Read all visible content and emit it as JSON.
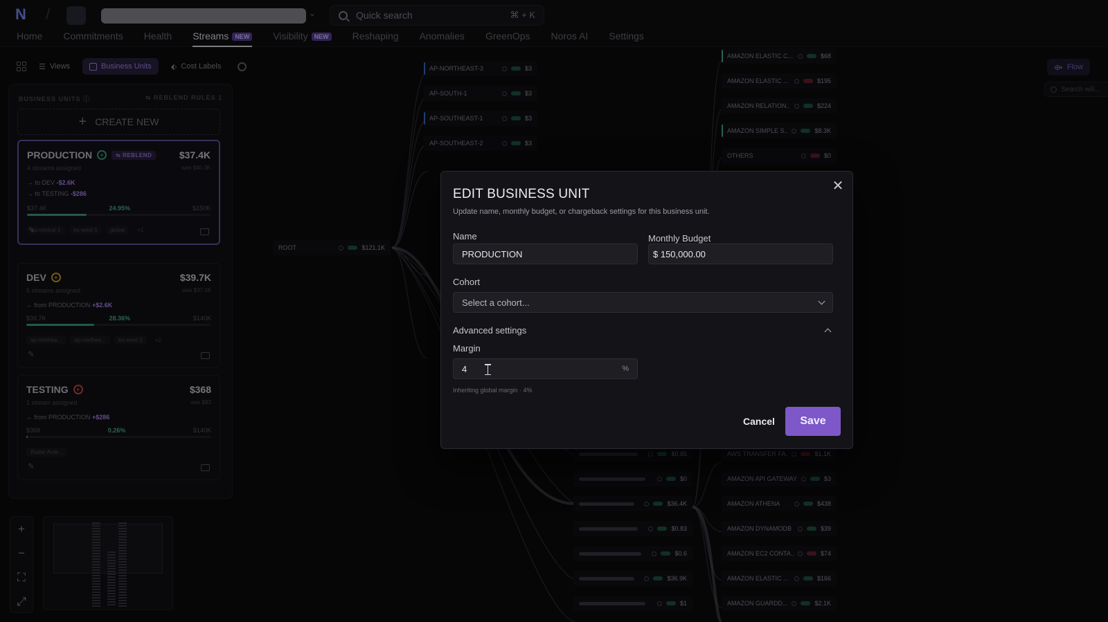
{
  "topbar": {
    "search_placeholder": "Quick search",
    "search_shortcut": "⌘ + K",
    "nav": [
      {
        "label": "Home"
      },
      {
        "label": "Commitments"
      },
      {
        "label": "Health"
      },
      {
        "label": "Streams",
        "badge": "NEW",
        "active": true
      },
      {
        "label": "Visibility",
        "badge": "NEW"
      },
      {
        "label": "Reshaping"
      },
      {
        "label": "Anomalies"
      },
      {
        "label": "GreenOps"
      },
      {
        "label": "Noros AI"
      },
      {
        "label": "Settings"
      }
    ]
  },
  "toolbar": {
    "views": "Views",
    "business_units": "Business Units",
    "cost_labels": "Cost Labels"
  },
  "panel": {
    "heading": "BUSINESS UNITS",
    "reblend_rules": "REBLEND RULES",
    "reblend_count": "1",
    "create_new": "CREATE NEW",
    "cards": [
      {
        "name": "PRODUCTION",
        "badge": "REBLEND",
        "cost": "$37.4K",
        "sub": "4 streams assigned",
        "was": "was $40.3K",
        "flows": [
          {
            "text": "→ to DEV",
            "value": "-$2.6K"
          },
          {
            "text": "→ to TESTING",
            "value": "-$286"
          }
        ],
        "spend": "$37.4K",
        "pct": "24.95%",
        "budget": "$150K",
        "fill": 0.2495,
        "tags": [
          "eu-central-1",
          "eu-west-1",
          "global",
          "+1"
        ],
        "status_color": "#3fa57e"
      },
      {
        "name": "DEV",
        "cost": "$39.7K",
        "sub": "5 streams assigned",
        "was": "was $37.1K",
        "flows": [
          {
            "text": "← from PRODUCTION",
            "value": "+$2.6K"
          }
        ],
        "spend": "$39.7K",
        "pct": "28.36%",
        "budget": "$140K",
        "fill": 0.2836,
        "tags": [
          "ap-northea...",
          "ap-northea...",
          "eu-west-2",
          "+2"
        ],
        "status_color": "#d4a52a"
      },
      {
        "name": "TESTING",
        "cost": "$368",
        "sub": "1 stream assigned",
        "was": "was $83",
        "flows": [
          {
            "text": "← from PRODUCTION",
            "value": "+$286"
          }
        ],
        "spend": "$368",
        "pct": "0.26%",
        "budget": "$140K",
        "fill": 0.0026,
        "tags": [
          "Radar Arde..."
        ],
        "status_color": "#d44a4a"
      }
    ]
  },
  "canvas": {
    "root": {
      "name": "ROOT",
      "value": "$121.1K"
    },
    "regions": [
      {
        "name": "AP-NORTHEAST-3",
        "value": "$3"
      },
      {
        "name": "AP-SOUTH-1",
        "value": "$3"
      },
      {
        "name": "AP-SOUTHEAST-1",
        "value": "$3"
      },
      {
        "name": "AP-SOUTHEAST-2",
        "value": "$3"
      }
    ],
    "services_top": [
      {
        "name": "AMAZON ELASTIC C...",
        "value": "$68"
      },
      {
        "name": "AMAZON ELASTIC ...",
        "value": "$195",
        "neg": true
      },
      {
        "name": "AMAZON RELATION...",
        "value": "$224"
      },
      {
        "name": "AMAZON SIMPLE S...",
        "value": "$8.3K"
      },
      {
        "name": "OTHERS",
        "value": "$0",
        "neg": true
      }
    ],
    "streams_bottom": [
      {
        "value": "$0.85"
      },
      {
        "value": "$0"
      },
      {
        "value": "$36.4K"
      },
      {
        "value": "$0.83"
      },
      {
        "value": "$0.6"
      },
      {
        "value": "$36.9K"
      },
      {
        "value": "$1"
      }
    ],
    "services_bottom": [
      {
        "name": "AWS TRANSFER FA...",
        "value": "$1.1K",
        "neg": true
      },
      {
        "name": "AMAZON API GATEWAY",
        "value": "$3"
      },
      {
        "name": "AMAZON ATHENA",
        "value": "$438"
      },
      {
        "name": "AMAZON DYNAMODB",
        "value": "$39"
      },
      {
        "name": "AMAZON EC2 CONTA...",
        "value": "$74",
        "neg": true
      },
      {
        "name": "AMAZON ELASTIC ...",
        "value": "$166"
      },
      {
        "name": "AMAZON GUARDD...",
        "value": "$2.1K"
      }
    ],
    "flow_button": "Flow",
    "search_placeholder": "Search will..."
  },
  "modal": {
    "title": "EDIT BUSINESS UNIT",
    "description": "Update name, monthly budget, or chargeback settings for this business unit.",
    "name_label": "Name",
    "name_value": "PRODUCTION",
    "budget_label": "Monthly Budget",
    "budget_value": "$ 150,000.00",
    "cohort_label": "Cohort",
    "cohort_placeholder": "Select a cohort...",
    "advanced_label": "Advanced settings",
    "margin_label": "Margin",
    "margin_value": "4",
    "margin_suffix": "%",
    "margin_hint": "Inheriting global margin · 4%",
    "cancel": "Cancel",
    "save": "Save"
  },
  "colors": {
    "accent": "#7e58c8",
    "positive": "#3fa57e",
    "reblend": "#b48cff"
  }
}
